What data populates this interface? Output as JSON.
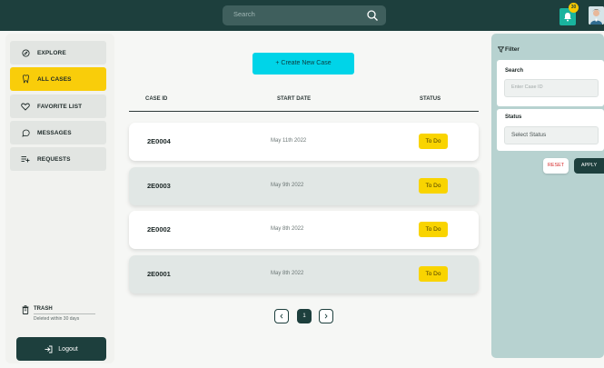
{
  "topbar": {
    "search_placeholder": "Search",
    "notification_count": "30"
  },
  "sidebar": {
    "items": [
      {
        "label": "EXPLORE",
        "icon": "compass-icon",
        "active": false
      },
      {
        "label": "ALL CASES",
        "icon": "tooth-icon",
        "active": true
      },
      {
        "label": "FAVORITE LIST",
        "icon": "heart-icon",
        "active": false
      },
      {
        "label": "MESSAGES",
        "icon": "chat-bubble-icon",
        "active": false
      },
      {
        "label": "REQUESTS",
        "icon": "list-plus-icon",
        "active": false
      }
    ],
    "trash_title": "TRASH",
    "trash_subtitle": "Deleted within 30 days",
    "logout_label": "Logout"
  },
  "main": {
    "create_label": "+ Create New Case",
    "columns": [
      "CASE ID",
      "START DATE",
      "STATUS"
    ],
    "rows": [
      {
        "id": "2E0004",
        "date": "May 11th 2022",
        "status": "To Do"
      },
      {
        "id": "2E0003",
        "date": "May 9th 2022",
        "status": "To Do"
      },
      {
        "id": "2E0002",
        "date": "May 8th 2022",
        "status": "To Do"
      },
      {
        "id": "2E0001",
        "date": "May 8th 2022",
        "status": "To Do"
      }
    ],
    "pagination": {
      "current": "1"
    }
  },
  "filter": {
    "title": "Filter",
    "search_title": "Search",
    "search_placeholder": "Enter Case ID",
    "status_title": "Status",
    "status_value": "Select Status",
    "reset_label": "RESET",
    "apply_label": "APPLY"
  },
  "colors": {
    "primary_dark": "#1d3f3d",
    "accent_yellow": "#f9cd0a",
    "accent_cyan": "#00d4e8",
    "filter_panel": "#b7d2d0"
  }
}
